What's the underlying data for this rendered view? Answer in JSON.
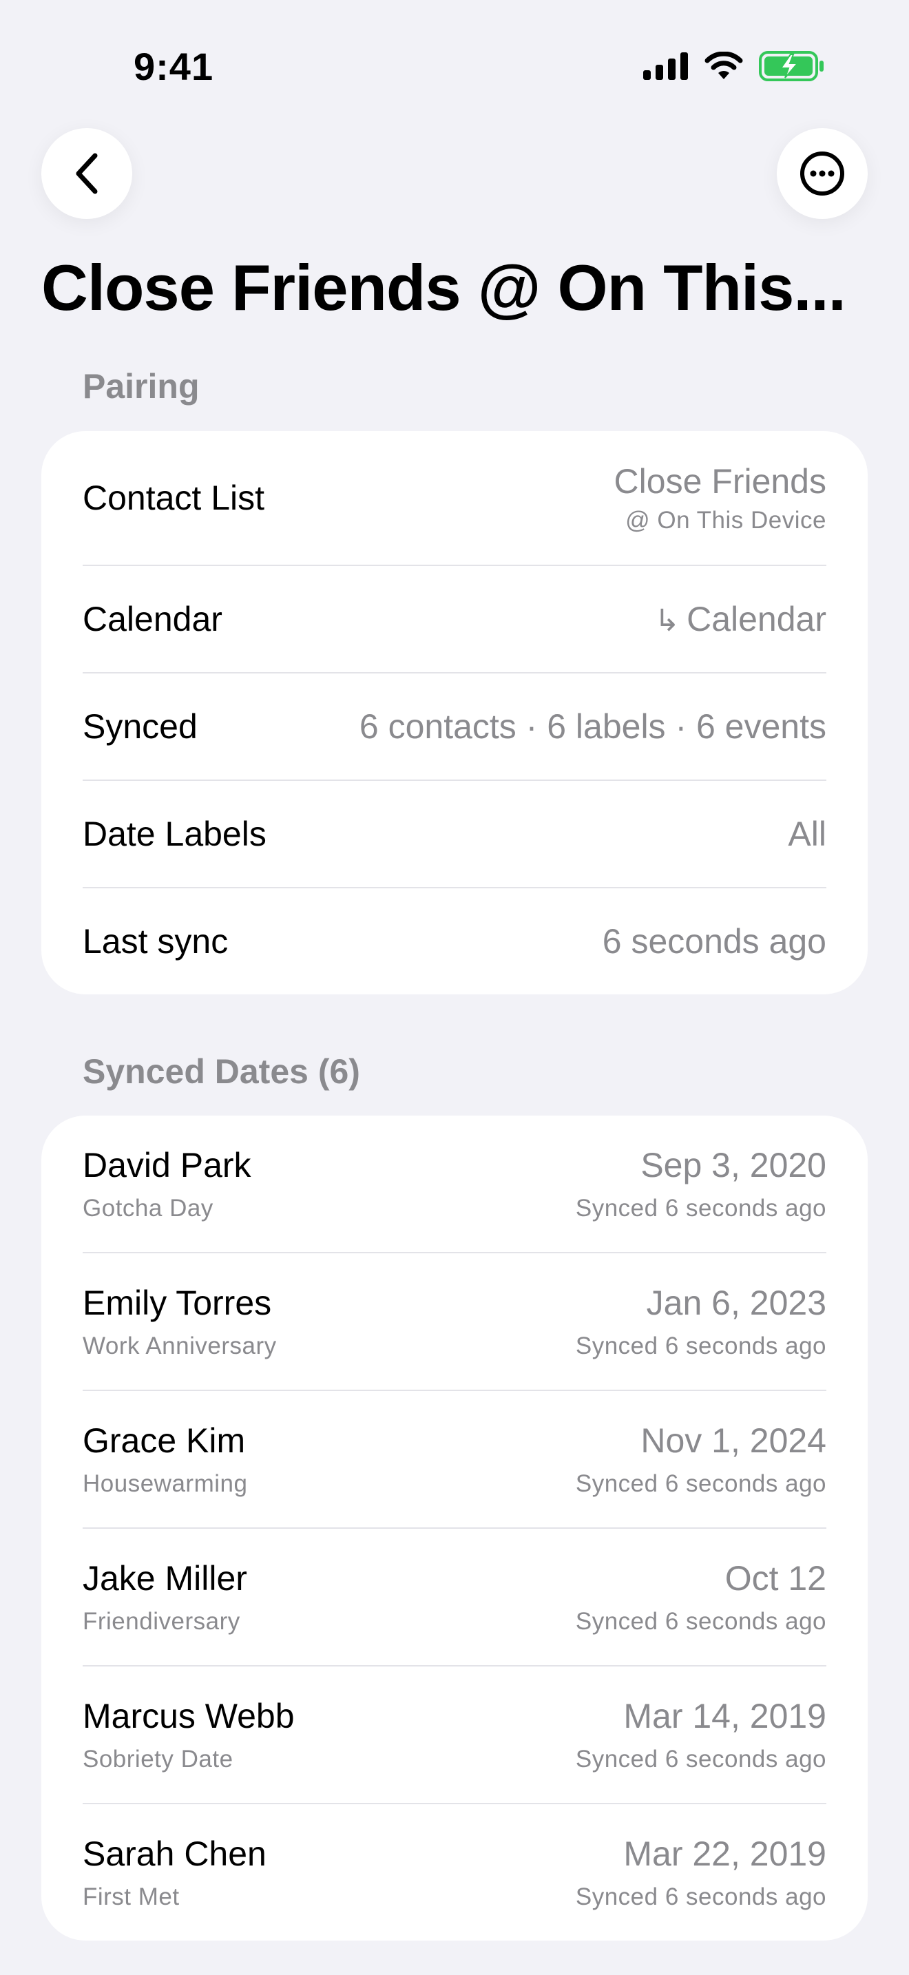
{
  "status_bar": {
    "time": "9:41",
    "icons": [
      "cellular-signal-icon",
      "wifi-icon",
      "battery-charging-icon"
    ],
    "battery_color": "#34c759"
  },
  "nav": {
    "back_icon": "chevron-left-icon",
    "more_icon": "ellipsis-circle-icon"
  },
  "title": "Close Friends @ On This...",
  "pairing": {
    "header": "Pairing",
    "rows": [
      {
        "label": "Contact List",
        "value": "Close Friends",
        "value_sub": "@ On This Device"
      },
      {
        "label": "Calendar",
        "value": "Calendar",
        "icon": "return-arrow-icon"
      },
      {
        "label": "Synced",
        "value": "6 contacts · 6 labels · 6 events"
      },
      {
        "label": "Date Labels",
        "value": "All"
      },
      {
        "label": "Last sync",
        "value": "6 seconds ago"
      }
    ]
  },
  "synced_dates": {
    "header": "Synced Dates (6)",
    "items": [
      {
        "name": "David Park",
        "label": "Gotcha Day",
        "date": "Sep 3, 2020",
        "synced": "Synced 6 seconds ago"
      },
      {
        "name": "Emily Torres",
        "label": "Work Anniversary",
        "date": "Jan 6, 2023",
        "synced": "Synced 6 seconds ago"
      },
      {
        "name": "Grace Kim",
        "label": "Housewarming",
        "date": "Nov 1, 2024",
        "synced": "Synced 6 seconds ago"
      },
      {
        "name": "Jake Miller",
        "label": "Friendiversary",
        "date": "Oct 12",
        "synced": "Synced 6 seconds ago"
      },
      {
        "name": "Marcus Webb",
        "label": "Sobriety Date",
        "date": "Mar 14, 2019",
        "synced": "Synced 6 seconds ago"
      },
      {
        "name": "Sarah Chen",
        "label": "First Met",
        "date": "Mar 22, 2019",
        "synced": "Synced 6 seconds ago"
      }
    ]
  }
}
